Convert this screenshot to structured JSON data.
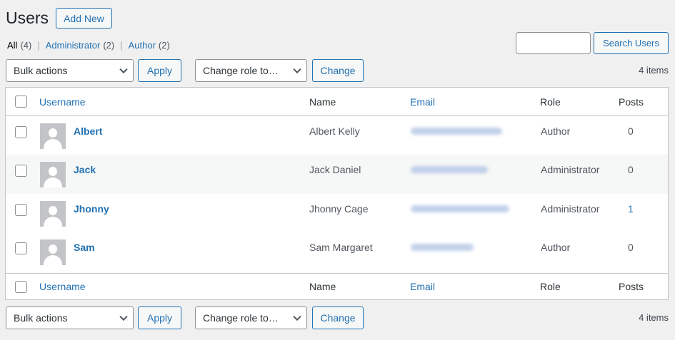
{
  "page": {
    "title": "Users",
    "add_new_label": "Add New"
  },
  "filters": [
    {
      "label": "All",
      "count": "(4)"
    },
    {
      "label": "Administrator",
      "count": "(2)"
    },
    {
      "label": "Author",
      "count": "(2)"
    }
  ],
  "filter_separator": "|",
  "search": {
    "button_label": "Search Users",
    "value": ""
  },
  "bulk": {
    "selected": "Bulk actions",
    "apply_label": "Apply"
  },
  "role_change": {
    "selected": "Change role to…",
    "change_label": "Change"
  },
  "items_count": "4 items",
  "table": {
    "columns": [
      "Username",
      "Name",
      "Email",
      "Role",
      "Posts"
    ],
    "rows": [
      {
        "username": "Albert",
        "name": "Albert Kelly",
        "role": "Author",
        "posts": "0"
      },
      {
        "username": "Jack",
        "name": "Jack Daniel",
        "role": "Administrator",
        "posts": "0"
      },
      {
        "username": "Jhonny",
        "name": "Jhonny Cage",
        "role": "Administrator",
        "posts": "1"
      },
      {
        "username": "Sam",
        "name": "Sam Margaret",
        "role": "Author",
        "posts": "0"
      }
    ]
  },
  "icons": {
    "avatar": "default-avatar-icon",
    "dropdown": "chevron-down-icon"
  },
  "colors": {
    "accent": "#2271b1",
    "background": "#f0f0f1",
    "border": "#c3c4c7"
  }
}
